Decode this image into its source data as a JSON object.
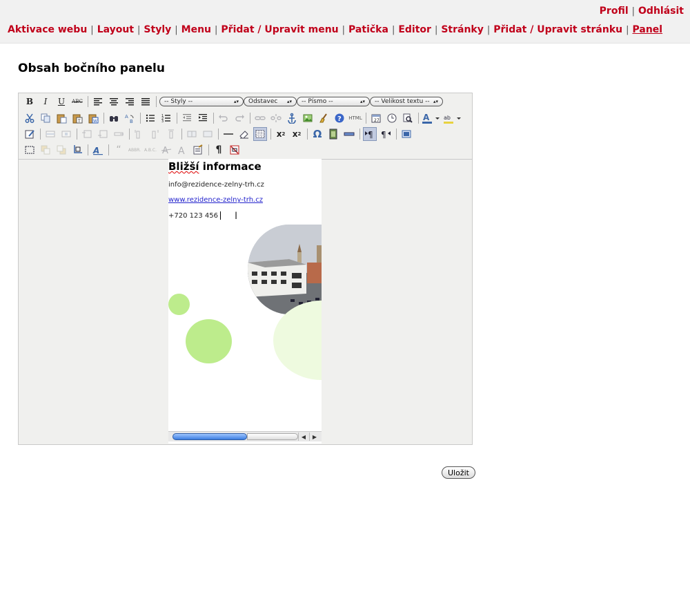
{
  "user_menu": {
    "profile": "Profil",
    "logout": "Odhlásit"
  },
  "nav": {
    "items": [
      "Aktivace webu",
      "Layout",
      "Styly",
      "Menu",
      "Přidat / Upravit menu",
      "Patička",
      "Editor",
      "Stránky",
      "Přidat / Upravit stránku",
      "Panel"
    ],
    "separator": "|",
    "active": "Panel"
  },
  "page": {
    "title": "Obsah bočního panelu"
  },
  "editor": {
    "toolbar": {
      "styles_select": "-- Styly --",
      "format_select": "Odstavec",
      "font_select": "-- Písmo --",
      "size_select": "-- Velikost textu --",
      "bold": "B",
      "italic": "I",
      "underline": "U",
      "strike": "ABC",
      "html": "HTML",
      "abbr": "ABBR.",
      "acronym": "A.B.C.",
      "omega": "Ω",
      "pilcrow": "¶",
      "subscript": "x",
      "superscript": "x"
    },
    "content": {
      "heading": "Bližší informace",
      "email": "info@rezidence-zelny-trh.cz",
      "website": "www.rezidence-zelny-trh.cz",
      "phone": "+720 123 456"
    }
  },
  "save_label": "Uložit",
  "colors": {
    "accent": "#c0001a",
    "blob_green": "#bdec8c",
    "blob_pale": "#eefadf"
  }
}
